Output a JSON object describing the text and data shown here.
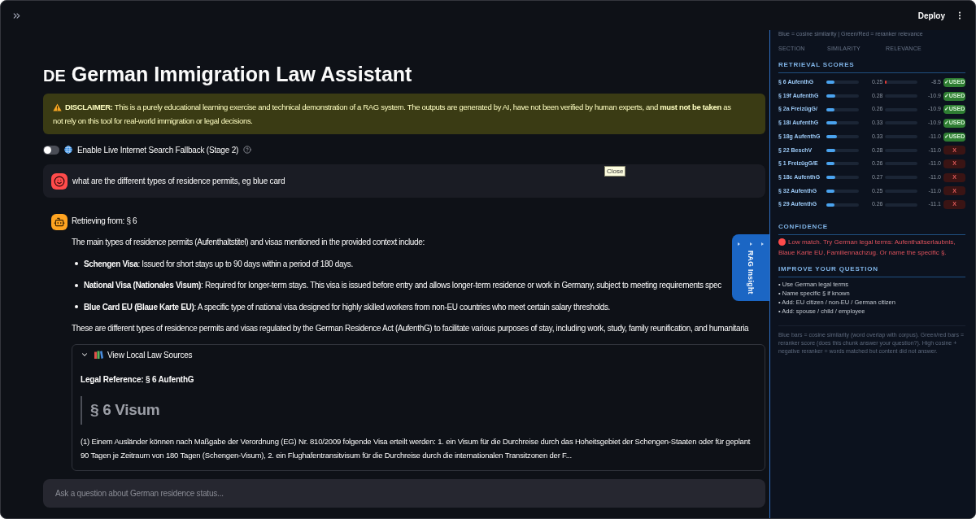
{
  "header": {
    "deploy_label": "Deploy"
  },
  "title": {
    "flag": "DE",
    "text": "German Immigration Law Assistant"
  },
  "disclaimer": {
    "lines": [
      "**DISCLAIMER:** This is a purely educational learning exercise and technical demonstration of a RAG system. The outputs are generated by AI, have not been verified by human experts, and **must not be taken** as",
      "not rely on this tool for real-world immigration or legal decisions."
    ]
  },
  "search_toggle": {
    "label": "Enable Live Internet Search Fallback (Stage 2)",
    "on": false
  },
  "messages": [
    {
      "kind": "user",
      "text": "what are the different types of residence permits, eg blue card"
    },
    {
      "kind": "assistant",
      "status": "Retrieving from: § 6",
      "intro": "The main types of residence permits (Aufenthaltstitel) and visas mentioned in the provided context include:",
      "bullets": [
        "**Schengen Visa**: Issued for short stays up to 90 days within a period of 180 days.",
        "**National Visa (Nationales Visum)**: Required for longer-term stays. This visa is issued before entry and allows longer-term residence or work in Germany, subject to meeting requirements spec",
        "**Blue Card EU (Blaue Karte EU)**: A specific type of national visa designed for highly skilled workers from non-EU countries who meet certain salary thresholds."
      ],
      "outro": "These are different types of residence permits and visas regulated by the German Residence Act (AufenthG) to facilitate various purposes of stay, including work, study, family reunification, and humanitaria",
      "sources": {
        "label": "View Local Law Sources",
        "expanded": true,
        "reference": "Legal Reference: § 6 AufenthG",
        "heading": "§ 6 Visum",
        "lines": [
          "(1) Einem Ausländer können nach Maßgabe der Verordnung (EG) Nr. 810/2009 folgende Visa erteilt werden: 1. ein Visum für die Durchreise durch das Hoheitsgebiet der Schengen-Staaten oder für geplant",
          "90 Tagen je Zeitraum von 180 Tagen (Schengen-Visum), 2. ein Flughafentransitvisum für die Durchreise durch die internationalen Transitzonen der F..."
        ]
      }
    }
  ],
  "tooltip": {
    "text": "Close"
  },
  "chat_input": {
    "placeholder": "Ask a question about German residence status..."
  },
  "rag_tab": {
    "label": "RAG Insight"
  },
  "panel": {
    "legend": "Blue = cosine similarity | Green/Red = reranker relevance",
    "columns": [
      "SECTION",
      "SIMILARITY",
      "RELEVANCE"
    ],
    "scores_title": "RETRIEVAL SCORES",
    "scores": [
      {
        "section": "§ 6 AufenthG",
        "similarity": {
          "level": 0.25,
          "reading": "0.25"
        },
        "relevance": {
          "level": 0.05,
          "reading": "-8.5"
        },
        "used": true,
        "badge": "✓USED"
      },
      {
        "section": "§ 19f AufenthG",
        "similarity": {
          "level": 0.28,
          "reading": "0.28"
        },
        "relevance": {
          "reading": "-10.9"
        },
        "used": true,
        "badge": "✓USED"
      },
      {
        "section": "§ 2a FreizügG/",
        "similarity": {
          "level": 0.26,
          "reading": "0.26"
        },
        "relevance": {
          "reading": "-10.9"
        },
        "used": true,
        "badge": "✓USED"
      },
      {
        "section": "§ 18i AufenthG",
        "similarity": {
          "level": 0.33,
          "reading": "0.33"
        },
        "relevance": {
          "reading": "-10.9"
        },
        "used": true,
        "badge": "✓USED"
      },
      {
        "section": "§ 18g AufenthG",
        "similarity": {
          "level": 0.33,
          "reading": "0.33"
        },
        "relevance": {
          "reading": "-11.0"
        },
        "used": true,
        "badge": "✓USED"
      },
      {
        "section": "§ 22 BeschV",
        "similarity": {
          "level": 0.28,
          "reading": "0.28"
        },
        "relevance": {
          "reading": "-11.0"
        },
        "used": false,
        "badge": "X"
      },
      {
        "section": "§ 1 FreizügG/E",
        "similarity": {
          "level": 0.26,
          "reading": "0.26"
        },
        "relevance": {
          "reading": "-11.0"
        },
        "used": false,
        "badge": "X"
      },
      {
        "section": "§ 18c AufenthG",
        "similarity": {
          "level": 0.27,
          "reading": "0.27"
        },
        "relevance": {
          "reading": "-11.0"
        },
        "used": false,
        "badge": "X"
      },
      {
        "section": "§ 32 AufenthG",
        "similarity": {
          "level": 0.25,
          "reading": "0.25"
        },
        "relevance": {
          "reading": "-11.0"
        },
        "used": false,
        "badge": "X"
      },
      {
        "section": "§ 29 AufenthG",
        "similarity": {
          "level": 0.26,
          "reading": "0.26"
        },
        "relevance": {
          "reading": "-11.1"
        },
        "used": false,
        "badge": "X"
      }
    ],
    "confidence_title": "CONFIDENCE",
    "confidence": {
      "warning": true,
      "text": "Low match. Try German legal terms: Aufenthaltserlaubnis, Blaue Karte EU, Familiennachzug. Or name the specific §."
    },
    "improve_title": "IMPROVE YOUR QUESTION",
    "tips": [
      "• Use German legal terms",
      "• Name specific § if known",
      "• Add: EU citizen / non-EU / German citizen",
      "• Add: spouse / child / employee"
    ],
    "footnote": "Blue bars = cosine similarity (word overlap with corpus). Green/red bars = reranker score (does this chunk answer your question?). High cosine + negative reranker = words matched but content did not answer."
  }
}
